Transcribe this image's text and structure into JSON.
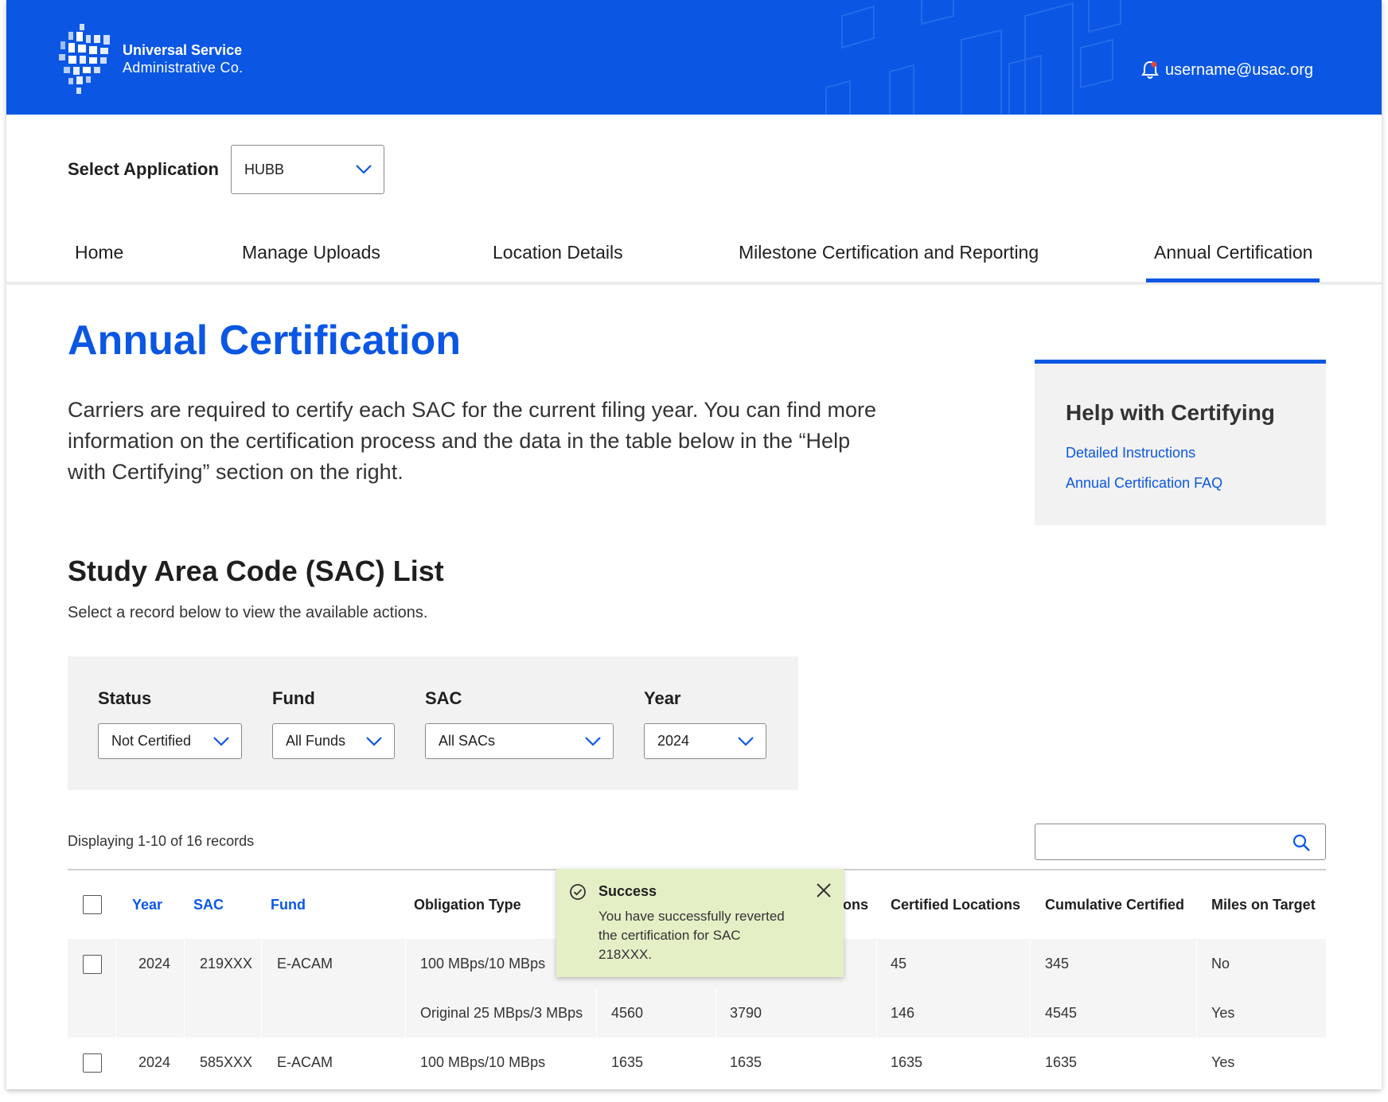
{
  "header": {
    "brand_name": "Universal Service",
    "brand_sub": "Administrative Co.",
    "user_email": "username@usac.org"
  },
  "app_select": {
    "label": "Select Application",
    "value": "HUBB"
  },
  "nav": {
    "items": [
      "Home",
      "Manage Uploads",
      "Location Details",
      "Milestone Certification and Reporting",
      "Annual Certification"
    ],
    "active": "Annual Certification"
  },
  "page": {
    "title": "Annual Certification",
    "intro": "Carriers are required to certify each SAC for the current filing year. You can find more information on the certification process and the data in the table below in the “Help with Certifying” section on the right."
  },
  "help": {
    "title": "Help with Certifying",
    "links": [
      "Detailed Instructions",
      "Annual Certification FAQ"
    ]
  },
  "sac_list": {
    "title": "Study Area Code (SAC) List",
    "subtitle": "Select a record below to view the available actions."
  },
  "filters": {
    "status": {
      "label": "Status",
      "value": "Not Certified"
    },
    "fund": {
      "label": "Fund",
      "value": "All Funds"
    },
    "sac": {
      "label": "SAC",
      "value": "All SACs"
    },
    "year": {
      "label": "Year",
      "value": "2024"
    }
  },
  "records_text": "Displaying 1-10 of 16 records",
  "table": {
    "headers": {
      "year": "Year",
      "sac": "SAC",
      "fund": "Fund",
      "obligation_type": "Obligation Type",
      "locations_partial": "ons",
      "certified_locations": "Certified Locations",
      "cumulative_certified": "Cumulative Certified",
      "miles_on_target": "Miles on Target"
    },
    "rows": [
      {
        "year": "2024",
        "sac": "219XXX",
        "fund": "E-ACAM",
        "lines": [
          {
            "obligation": "100 MBps/10 MBps",
            "col5": "",
            "col6": "",
            "certified": "45",
            "cumulative": "345",
            "miles": "No"
          },
          {
            "obligation": "Original 25 MBps/3 MBps",
            "col5": "4560",
            "col6": "3790",
            "certified": "146",
            "cumulative": "4545",
            "miles": "Yes"
          }
        ]
      },
      {
        "year": "2024",
        "sac": "585XXX",
        "fund": "E-ACAM",
        "lines": [
          {
            "obligation": "100 MBps/10 MBps",
            "col5": "1635",
            "col6": "1635",
            "certified": "1635",
            "cumulative": "1635",
            "miles": "Yes"
          }
        ]
      }
    ]
  },
  "toast": {
    "title": "Success",
    "message": "You have successfully reverted the certification for SAC 218XXX.",
    "color": "#e4efc6"
  },
  "colors": {
    "brand_blue": "#0b57e3",
    "panel_gray": "#f2f2f2"
  }
}
